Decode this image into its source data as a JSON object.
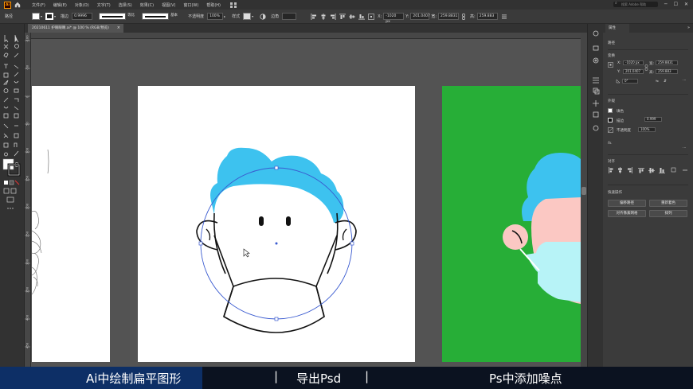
{
  "menubar": {
    "items": [
      "文件(F)",
      "编辑(E)",
      "对象(O)",
      "文字(T)",
      "选择(S)",
      "效果(C)",
      "视图(V)",
      "窗口(W)",
      "帮助(H)"
    ],
    "search_placeholder": "搜索 Adobe 帮助",
    "logo": "Ai"
  },
  "controlbar": {
    "object_label": "路径",
    "stroke_label": "描边",
    "stroke_value": "0.9996",
    "stroke_style_1": "等比",
    "stroke_style_2": "基本",
    "opacity_label": "不透明度",
    "opacity_value": "100%",
    "style_label": "样式",
    "corner_label": "边角",
    "x_value": "-1020 px",
    "y_value": "201.0407",
    "w_value": "259.8831",
    "h_value": "259.883"
  },
  "tab": {
    "title": "20210611 护眼眼睛.ai* @ 100 % (RGB/预览)",
    "close": "×"
  },
  "ruler": {
    "h_ticks": [
      "-1500",
      "-1450",
      "-1400",
      "-1350",
      "-1300",
      "-1250",
      "-1200",
      "-1150",
      "-1100",
      "-1050",
      "-1000",
      "-950",
      "-900",
      "-850",
      "-800",
      "-750",
      "-700",
      "-650"
    ],
    "v_ticks": [
      "-100",
      "-50",
      "0",
      "50",
      "100",
      "150",
      "200",
      "250",
      "300",
      "350",
      "400",
      "450"
    ]
  },
  "panel": {
    "tab_label": "属性",
    "section_path": "路径",
    "section_transform": "变换",
    "x_label": "X:",
    "x_value": "-1020 px",
    "y_label": "Y:",
    "y_value": "201.0407",
    "w_label": "宽:",
    "w_value": "259.8831",
    "h_label": "高:",
    "h_value": "259.883",
    "angle_value": "0°",
    "section_appearance": "外观",
    "fill_label": "填色",
    "stroke_label": "描边",
    "stroke_value": "0.999",
    "opacity_label": "不透明度",
    "opacity_value": "100%",
    "fx_label": "fx.",
    "section_align": "对齐",
    "section_quick": "快速操作",
    "btn_edit_path": "偏移路径",
    "btn_recolor": "重新着色",
    "btn_align_grid": "对齐像素网格",
    "btn_arrange": "排列"
  },
  "subtitle": {
    "part1": "Ai中绘制扁平图形",
    "sep1": "|",
    "part2": "导出Psd",
    "sep2": "|",
    "part3": "Ps中添加噪点"
  },
  "colors": {
    "hair_blue": "#3dc2ef",
    "green_bg": "#27ae37",
    "skin": "#fbc8c3",
    "mask_cyan": "#b7f3f7",
    "selection_blue": "#3a5bd0",
    "subtitle_highlight": "#0d2f66"
  }
}
